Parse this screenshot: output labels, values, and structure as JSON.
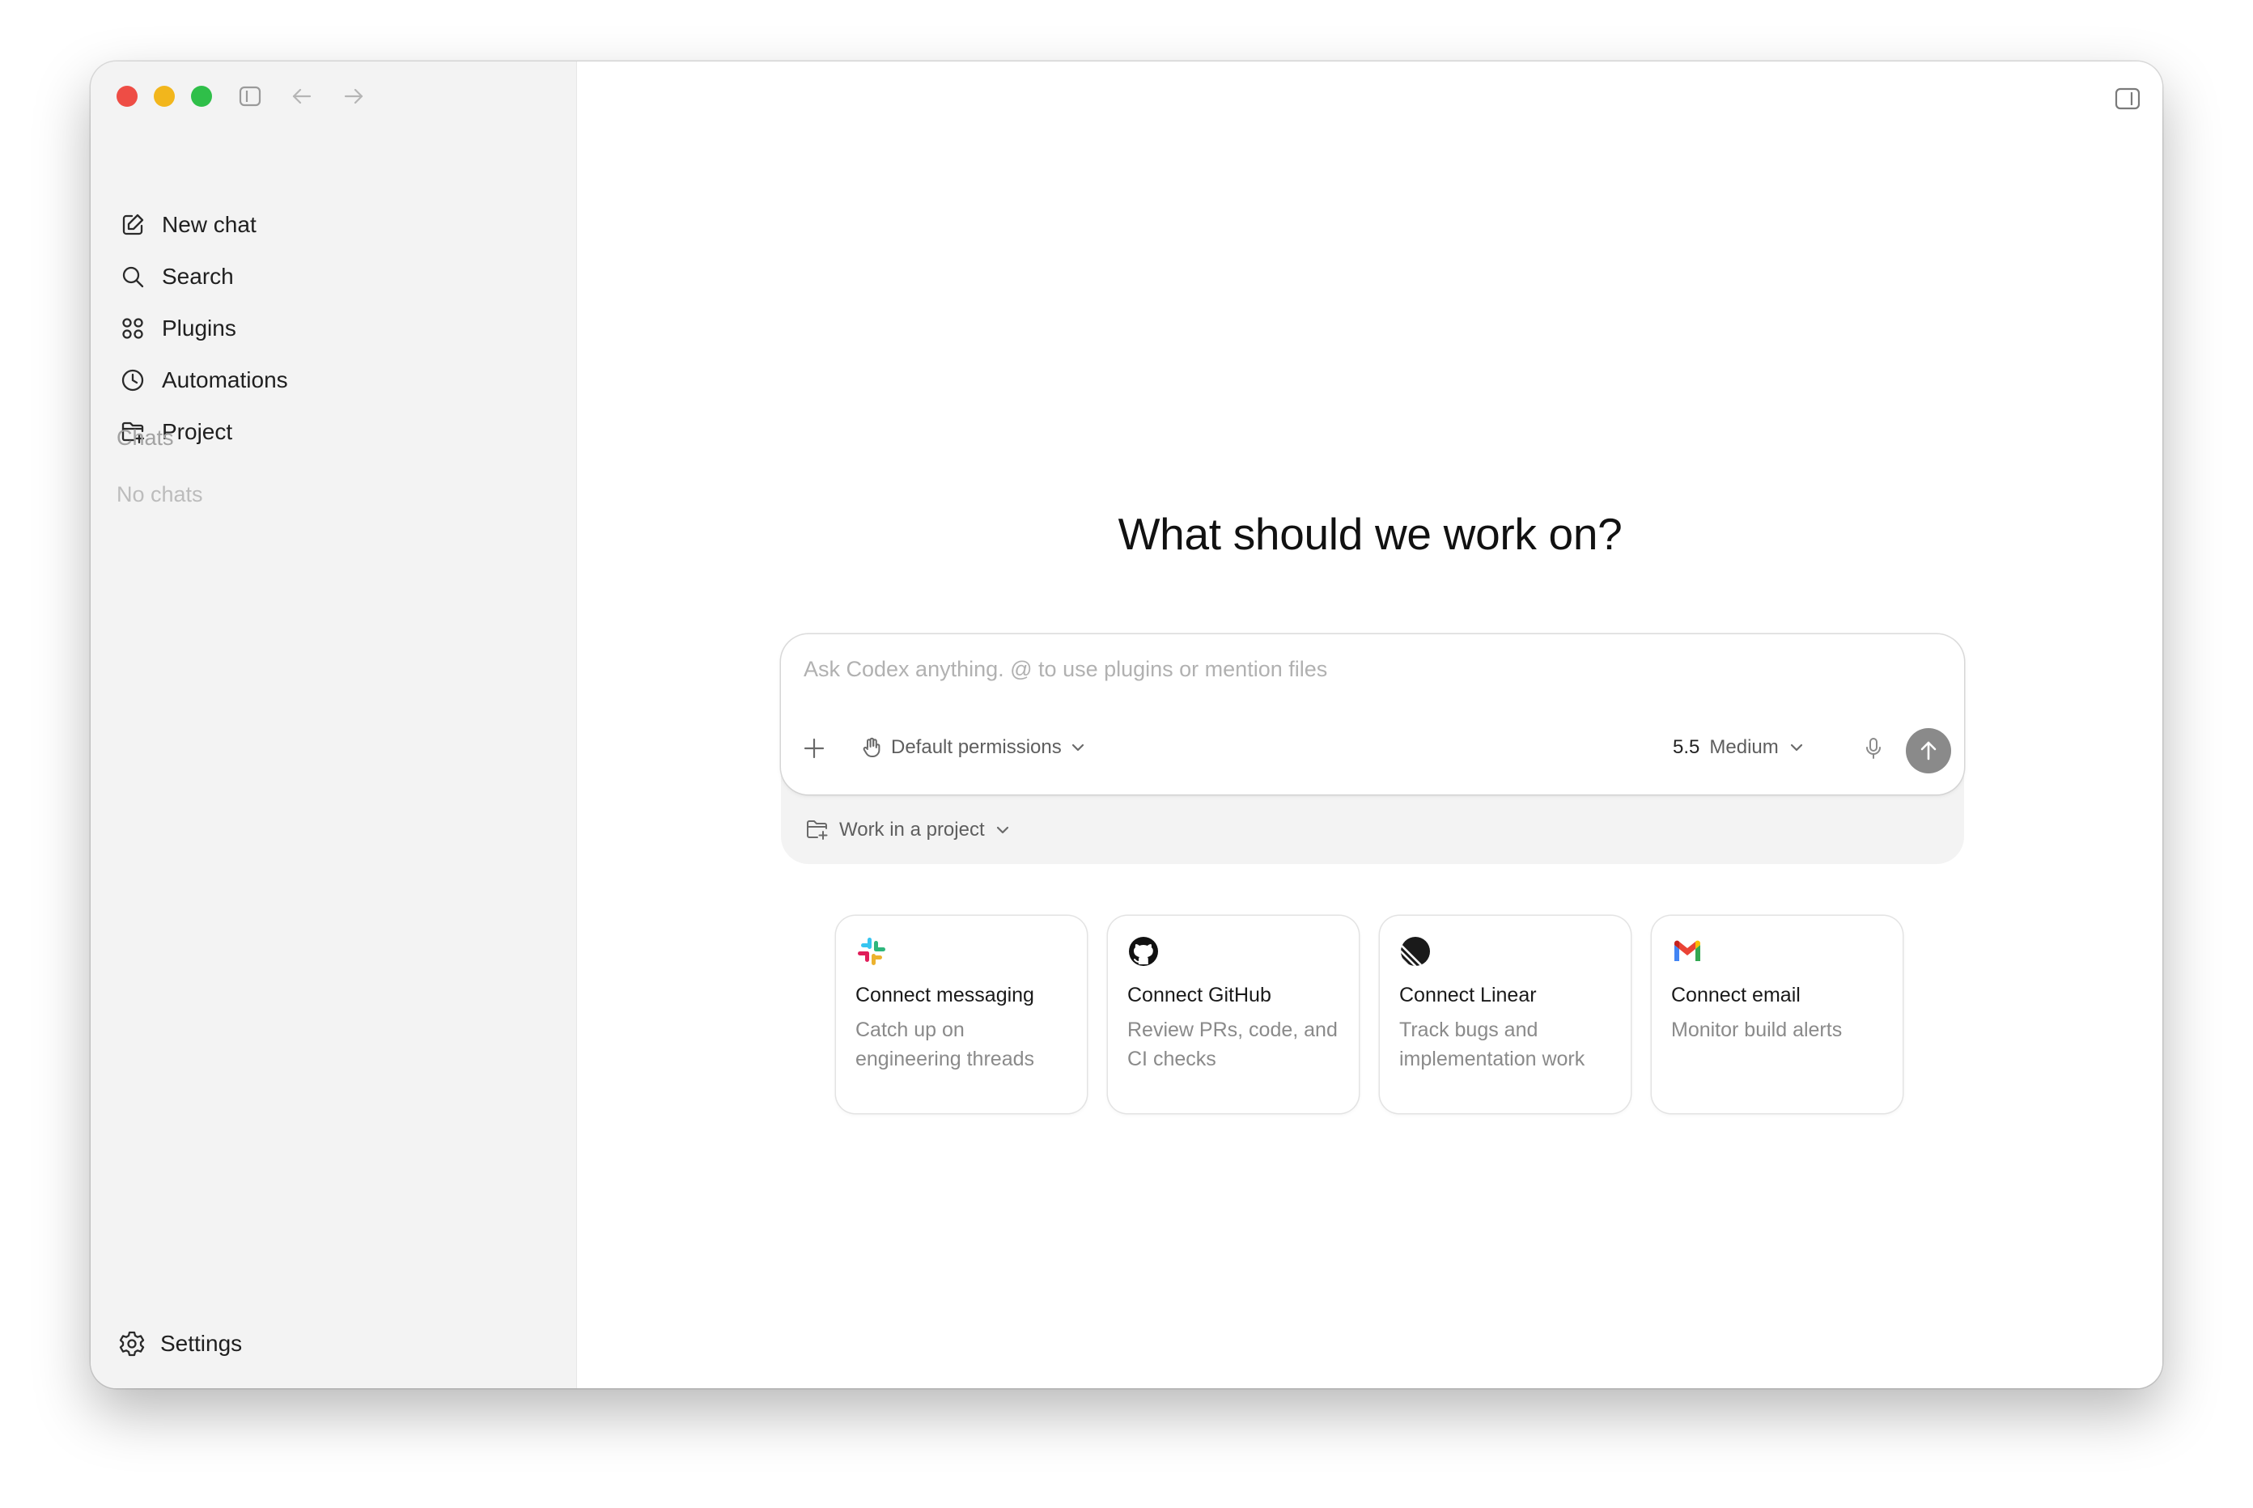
{
  "sidebar": {
    "nav": [
      {
        "label": "New chat",
        "icon": "compose-icon"
      },
      {
        "label": "Search",
        "icon": "search-icon"
      },
      {
        "label": "Plugins",
        "icon": "plugins-icon"
      },
      {
        "label": "Automations",
        "icon": "clock-icon"
      },
      {
        "label": "Project",
        "icon": "folder-add-icon"
      }
    ],
    "chats_label": "Chats",
    "no_chats": "No chats",
    "settings_label": "Settings"
  },
  "main": {
    "heading": "What should we work on?",
    "composer": {
      "placeholder": "Ask Codex anything. @ to use plugins or mention files",
      "value": "",
      "permissions_label": "Default permissions",
      "model_version": "5.5",
      "model_effort": "Medium",
      "project_label": "Work in a project"
    },
    "cards": [
      {
        "title": "Connect messaging",
        "desc": "Catch up on engineering threads",
        "icon": "slack-icon"
      },
      {
        "title": "Connect GitHub",
        "desc": "Review PRs, code, and CI checks",
        "icon": "github-icon"
      },
      {
        "title": "Connect Linear",
        "desc": "Track bugs and implementation work",
        "icon": "linear-icon"
      },
      {
        "title": "Connect email",
        "desc": "Monitor build alerts",
        "icon": "gmail-icon"
      }
    ]
  },
  "colors": {
    "close": "#ee4d45",
    "minimize": "#f2b61c",
    "maximize": "#2fbf49",
    "send_button": "#8a8a8a",
    "sidebar_bg": "#f3f3f3"
  }
}
